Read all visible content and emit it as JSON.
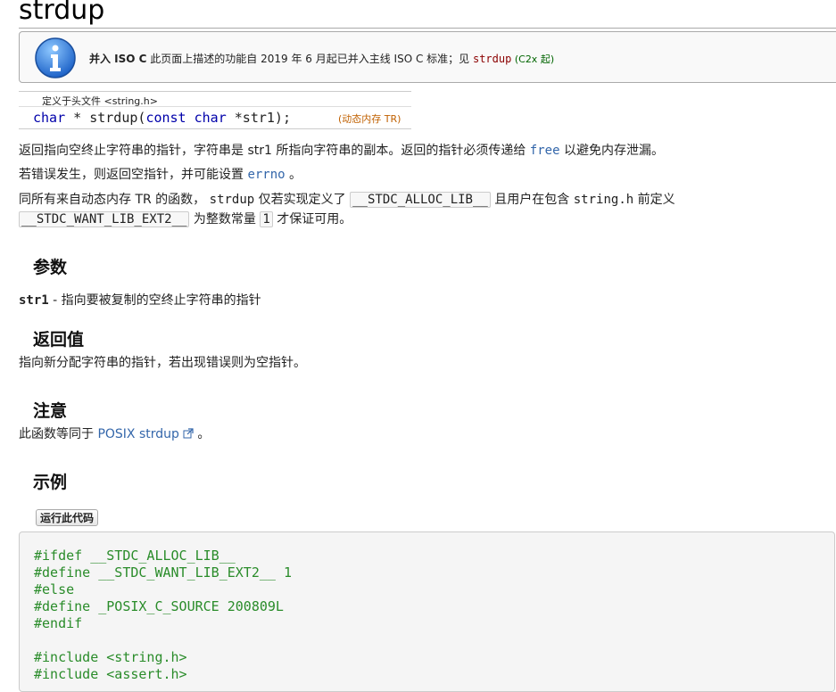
{
  "title": "strdup",
  "notice": {
    "bold": "并入 ISO C",
    "text": " 此页面上描述的功能自 2019 年 6 月起已并入主线 ISO C 标准；见 ",
    "fn": "strdup",
    "after": " (C2x 起)"
  },
  "declaration": {
    "header": "定义于头文件 <string.h>",
    "sig_kw1": "char",
    "sig_mid1": " * strdup(",
    "sig_kw2": "const char",
    "sig_end": " *str1);",
    "tag": "(动态内存 TR)"
  },
  "description": {
    "p1_a": "返回指向空终止字符串的指针，字符串是 str1 所指向字符串的副本。返回的指针必须传递给 ",
    "p1_link": "free",
    "p1_b": " 以避免内存泄漏。",
    "p2_a": "若错误发生，则返回空指针，并可能设置 ",
    "p2_link": "errno",
    "p2_b": " 。",
    "p3_a": "同所有来自动态内存 TR 的函数， ",
    "p3_code1": "strdup",
    "p3_b": " 仅若实现定义了 ",
    "p3_box1": "__STDC_ALLOC_LIB__",
    "p3_c": " 且用户在包含 ",
    "p3_code2": "string.h",
    "p3_d": " 前定义",
    "p4_box2": "__STDC_WANT_LIB_EXT2__",
    "p4_a": " 为整数常量 ",
    "p4_box3": "1",
    "p4_b": " 才保证可用。"
  },
  "params": {
    "heading": "参数",
    "name": "str1",
    "sep": " - ",
    "desc": " 指向要被复制的空终止字符串的指针"
  },
  "return": {
    "heading": "返回值",
    "text": "指向新分配字符串的指针，若出现错误则为空指针。"
  },
  "notes": {
    "heading": "注意",
    "text_a": "此函数等同于 ",
    "link": "POSIX strdup",
    "text_b": " 。"
  },
  "example": {
    "heading": "示例",
    "run_button": "运行此代码",
    "code_lines": [
      "#ifdef __STDC_ALLOC_LIB__",
      "#define __STDC_WANT_LIB_EXT2__ 1",
      "#else",
      "#define _POSIX_C_SOURCE 200809L",
      "#endif",
      "",
      "#include <string.h>",
      "#include <assert.h>"
    ]
  },
  "colors": {
    "link": "#3366aa",
    "code_green": "#2a8c2a",
    "notice_fn": "#8b0000",
    "tag_orange": "#c06000"
  }
}
